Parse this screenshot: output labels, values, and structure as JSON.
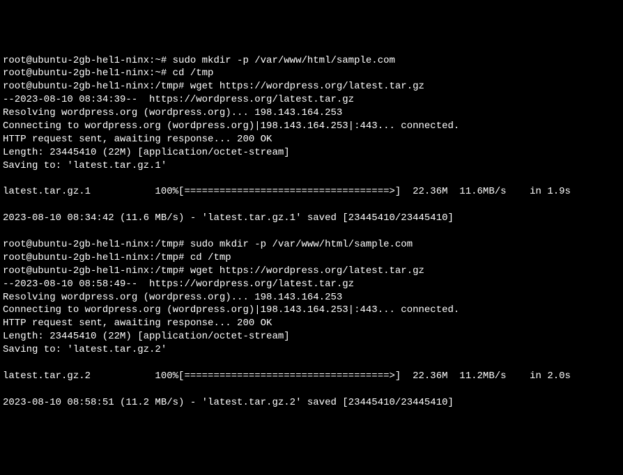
{
  "lines": [
    "root@ubuntu-2gb-hel1-ninx:~# sudo mkdir -p /var/www/html/sample.com",
    "root@ubuntu-2gb-hel1-ninx:~# cd /tmp",
    "root@ubuntu-2gb-hel1-ninx:/tmp# wget https://wordpress.org/latest.tar.gz",
    "--2023-08-10 08:34:39--  https://wordpress.org/latest.tar.gz",
    "Resolving wordpress.org (wordpress.org)... 198.143.164.253",
    "Connecting to wordpress.org (wordpress.org)|198.143.164.253|:443... connected.",
    "HTTP request sent, awaiting response... 200 OK",
    "Length: 23445410 (22M) [application/octet-stream]",
    "Saving to: 'latest.tar.gz.1'",
    "",
    "latest.tar.gz.1           100%[===================================>]  22.36M  11.6MB/s    in 1.9s",
    "",
    "2023-08-10 08:34:42 (11.6 MB/s) - 'latest.tar.gz.1' saved [23445410/23445410]",
    "",
    "root@ubuntu-2gb-hel1-ninx:/tmp# sudo mkdir -p /var/www/html/sample.com",
    "root@ubuntu-2gb-hel1-ninx:/tmp# cd /tmp",
    "root@ubuntu-2gb-hel1-ninx:/tmp# wget https://wordpress.org/latest.tar.gz",
    "--2023-08-10 08:58:49--  https://wordpress.org/latest.tar.gz",
    "Resolving wordpress.org (wordpress.org)... 198.143.164.253",
    "Connecting to wordpress.org (wordpress.org)|198.143.164.253|:443... connected.",
    "HTTP request sent, awaiting response... 200 OK",
    "Length: 23445410 (22M) [application/octet-stream]",
    "Saving to: 'latest.tar.gz.2'",
    "",
    "latest.tar.gz.2           100%[===================================>]  22.36M  11.2MB/s    in 2.0s",
    "",
    "2023-08-10 08:58:51 (11.2 MB/s) - 'latest.tar.gz.2' saved [23445410/23445410]"
  ]
}
